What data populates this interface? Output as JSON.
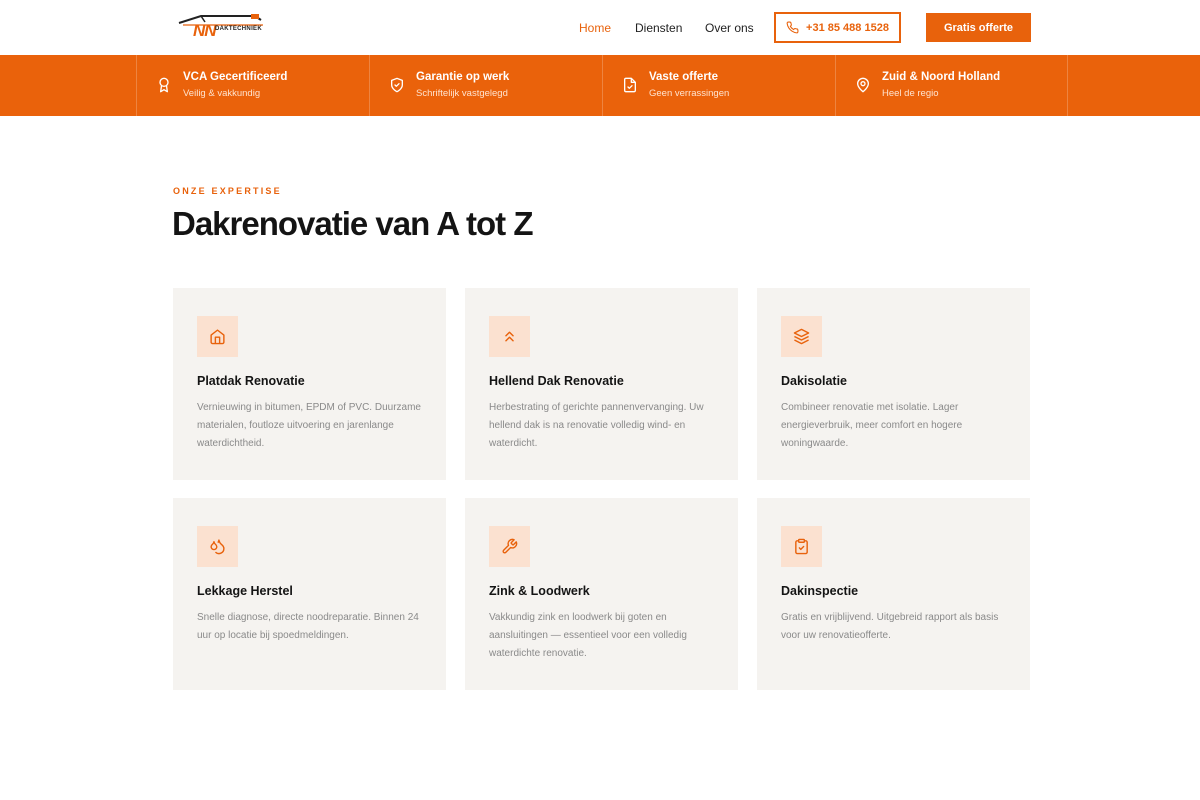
{
  "header": {
    "logo_text": "NN",
    "logo_sub": "DAKTECHNIEK",
    "nav": [
      {
        "label": "Home",
        "active": true
      },
      {
        "label": "Diensten",
        "active": false
      },
      {
        "label": "Over ons",
        "active": false
      }
    ],
    "phone_label": "+31 85 488 1528",
    "cta_label": "Gratis offerte"
  },
  "band": [
    {
      "title": "VCA Gecertificeerd",
      "subtitle": "Veilig & vakkundig",
      "icon": "award-icon"
    },
    {
      "title": "Garantie op werk",
      "subtitle": "Schriftelijk vastgelegd",
      "icon": "shield-check-icon"
    },
    {
      "title": "Vaste offerte",
      "subtitle": "Geen verrassingen",
      "icon": "file-check-icon"
    },
    {
      "title": "Zuid & Noord Holland",
      "subtitle": "Heel de regio",
      "icon": "map-pin-icon"
    }
  ],
  "section": {
    "eyebrow": "ONZE EXPERTISE",
    "heading": "Dakrenovatie van A tot Z"
  },
  "cards": [
    {
      "title": "Platdak Renovatie",
      "text": "Vernieuwing in bitumen, EPDM of PVC. Duurzame materialen, foutloze uitvoering en jarenlange waterdichtheid.",
      "icon": "home-icon"
    },
    {
      "title": "Hellend Dak Renovatie",
      "text": "Herbestrating of gerichte pannenvervanging. Uw hellend dak is na renovatie volledig wind- en waterdicht.",
      "icon": "chevrons-up-icon"
    },
    {
      "title": "Dakisolatie",
      "text": "Combineer renovatie met isolatie. Lager energieverbruik, meer comfort en hogere woningwaarde.",
      "icon": "layers-icon"
    },
    {
      "title": "Lekkage Herstel",
      "text": "Snelle diagnose, directe noodreparatie. Binnen 24 uur op locatie bij spoedmeldingen.",
      "icon": "droplets-icon"
    },
    {
      "title": "Zink & Loodwerk",
      "text": "Vakkundig zink en loodwerk bij goten en aansluitingen — essentieel voor een volledig waterdichte renovatie.",
      "icon": "wrench-icon"
    },
    {
      "title": "Dakinspectie",
      "text": "Gratis en vrijblijvend. Uitgebreid rapport als basis voor uw renovatieofferte.",
      "icon": "clipboard-check-icon"
    }
  ],
  "colors": {
    "accent": "#ea620b",
    "card_bg": "#f5f3f0",
    "icon_bg": "#fbe1d0"
  }
}
